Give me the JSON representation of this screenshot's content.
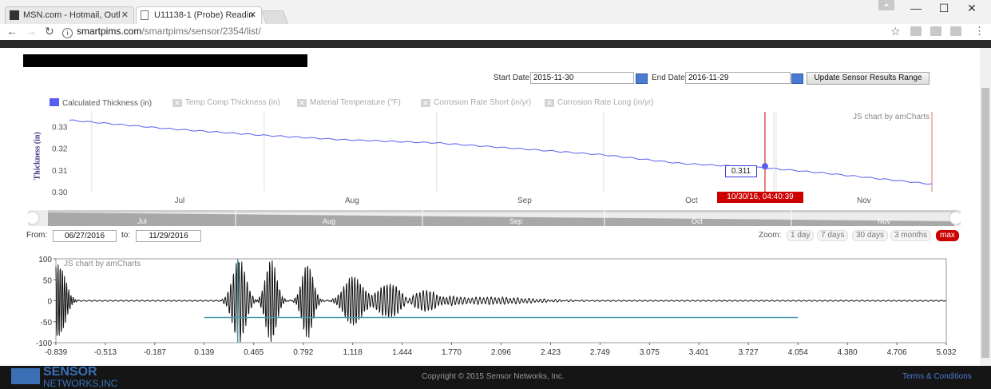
{
  "browser": {
    "tabs": [
      {
        "label": "MSN.com - Hotmail, Outl"
      },
      {
        "label": "U11138-1 (Probe) Readin"
      }
    ],
    "url_host": "smartpims.com",
    "url_path": "/smartpims/sensor/2354/list/"
  },
  "form": {
    "start_label": "Start Date:",
    "start_value": "2015-11-30",
    "end_label": "End Date:",
    "end_value": "2016-11-29",
    "update_button": "Update Sensor Results Range"
  },
  "legend": [
    {
      "label": "Calculated Thickness (in)",
      "enabled": true
    },
    {
      "label": "Temp Comp Thickness (in)",
      "enabled": false
    },
    {
      "label": "Material Temperature (°F)",
      "enabled": false
    },
    {
      "label": "Corrosion Rate Short (in/yr)",
      "enabled": false
    },
    {
      "label": "Corrosion Rate Long (in/yr)",
      "enabled": false
    }
  ],
  "chart_data": [
    {
      "type": "line",
      "ylabel": "Thickness (in)",
      "credit": "JS chart by amCharts",
      "ylim": [
        0.3,
        0.335
      ],
      "yticks": [
        "0.33",
        "0.32",
        "0.31",
        "0.30"
      ],
      "xticks": [
        "Jul",
        "Aug",
        "Sep",
        "Oct",
        "Nov"
      ],
      "x": [
        "2016-06-27",
        "2016-07-15",
        "2016-08-01",
        "2016-08-15",
        "2016-09-01",
        "2016-09-15",
        "2016-10-01",
        "2016-10-15",
        "2016-10-30",
        "2016-11-10",
        "2016-11-29"
      ],
      "series": [
        {
          "name": "Calculated Thickness (in)",
          "values": [
            0.333,
            0.329,
            0.326,
            0.324,
            0.3225,
            0.32,
            0.317,
            0.313,
            0.311,
            0.3085,
            0.3035
          ]
        }
      ],
      "cursor_value": "0.311",
      "cursor_time": "10/30/16, 04:40:39",
      "color": "#5a5ef0"
    },
    {
      "type": "line",
      "credit": "JS chart by amCharts",
      "xlim": [
        -0.839,
        5.032
      ],
      "ylim": [
        -100,
        100
      ],
      "yticks": [
        "100",
        "50",
        "0",
        "-50",
        "-100"
      ],
      "xticks": [
        "-0.839",
        "-0.513",
        "-0.187",
        "0.139",
        "0.465",
        "0.792",
        "1.118",
        "1.444",
        "1.770",
        "2.096",
        "2.423",
        "2.749",
        "3.075",
        "3.401",
        "3.727",
        "4.054",
        "4.380",
        "4.706",
        "5.032"
      ],
      "threshold": {
        "value": -40,
        "x_start": 0.139,
        "x_end": 4.054,
        "color": "#4a9aa8"
      },
      "waveform_color": "#111111"
    }
  ],
  "scroller_labels": [
    "Jul",
    "Aug",
    "Sep",
    "Oct",
    "Nov"
  ],
  "range": {
    "from_label": "From:",
    "from_value": "06/27/2016",
    "to_label": "to:",
    "to_value": "11/29/2016",
    "zoom_label": "Zoom:",
    "zoom_buttons": [
      "1 day",
      "7 days",
      "30 days",
      "3 months",
      "max"
    ]
  },
  "footer": {
    "logo_line1": "SENSOR",
    "logo_line2": "NETWORKS,INC",
    "copyright": "Copyright © 2015 Sensor Networks, Inc.",
    "terms": "Terms & Conditions"
  }
}
